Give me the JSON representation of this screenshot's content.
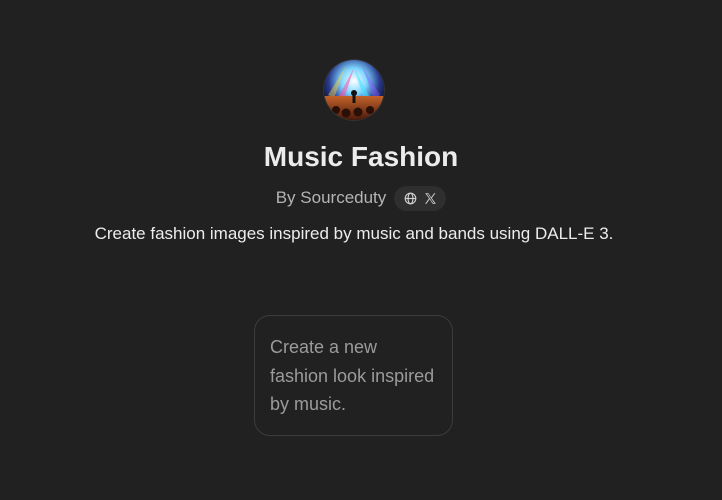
{
  "gpt": {
    "name": "Music Fashion",
    "byline": "By Sourceduty",
    "description": "Create fashion images inspired by music and bands using DALL-E 3.",
    "avatar_icon": "concert-stage-avatar",
    "social_icons": [
      "globe-icon",
      "x-logo-icon"
    ]
  },
  "conversation_starters": [
    {
      "text": "Create a new fashion look inspired by music."
    }
  ],
  "colors": {
    "background": "#212121",
    "title": "#ececec",
    "muted": "#b4b4b4",
    "pill": "#2f2f2f",
    "starter_border": "#3b3b3b",
    "starter_text": "#9b9b9b"
  }
}
